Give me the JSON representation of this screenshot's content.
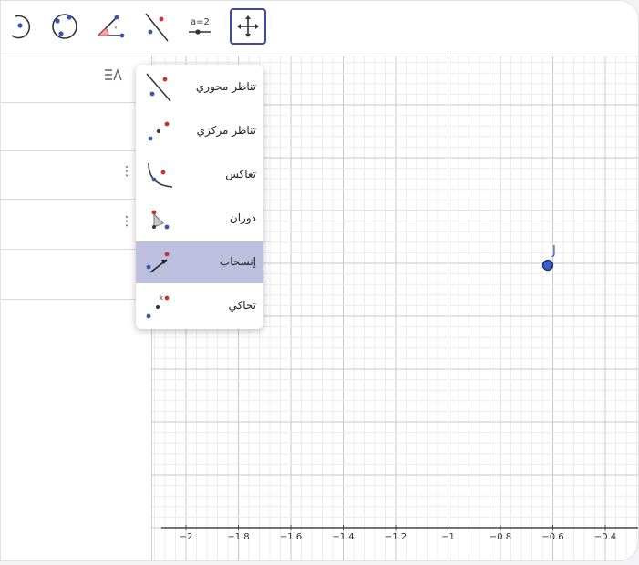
{
  "toolbar": {
    "tools": [
      {
        "name": "circle-point-tool",
        "icon": "circle-with-center-icon"
      },
      {
        "name": "circle-three-points-tool",
        "icon": "circle-three-points-icon"
      },
      {
        "name": "angle-tool",
        "icon": "angle-icon"
      },
      {
        "name": "reflect-line-tool",
        "icon": "reflect-line-icon"
      },
      {
        "name": "slider-tool",
        "icon": "slider-icon",
        "text": "a=2"
      },
      {
        "name": "move-graphics-tool",
        "icon": "move-arrows-icon",
        "selected": true
      }
    ]
  },
  "algebra": {
    "sort_icon": "algebra-sort-icon"
  },
  "transform_menu": {
    "items": [
      {
        "label": "تناظر محوري",
        "icon": "reflect-about-line-icon"
      },
      {
        "label": "تناظر مركزي",
        "icon": "reflect-about-point-icon"
      },
      {
        "label": "تعاكس",
        "icon": "reflect-about-circle-icon"
      },
      {
        "label": "دوران",
        "icon": "rotate-around-point-icon"
      },
      {
        "label": "إنسحاب",
        "icon": "translate-by-vector-icon",
        "active": true
      },
      {
        "label": "تحاكي",
        "icon": "dilate-from-point-icon"
      }
    ]
  },
  "graphics": {
    "point": {
      "label": "J",
      "color": "#2f57c4"
    },
    "x_axis_ticks": [
      "−2",
      "−1.8",
      "−1.6",
      "−1.4",
      "−1.2",
      "−1",
      "−0.8",
      "−0.6",
      "−0.4"
    ]
  },
  "colors": {
    "accent": "#3b4ba8",
    "menu_active": "#bcc0de",
    "point": "#2f57c4"
  }
}
